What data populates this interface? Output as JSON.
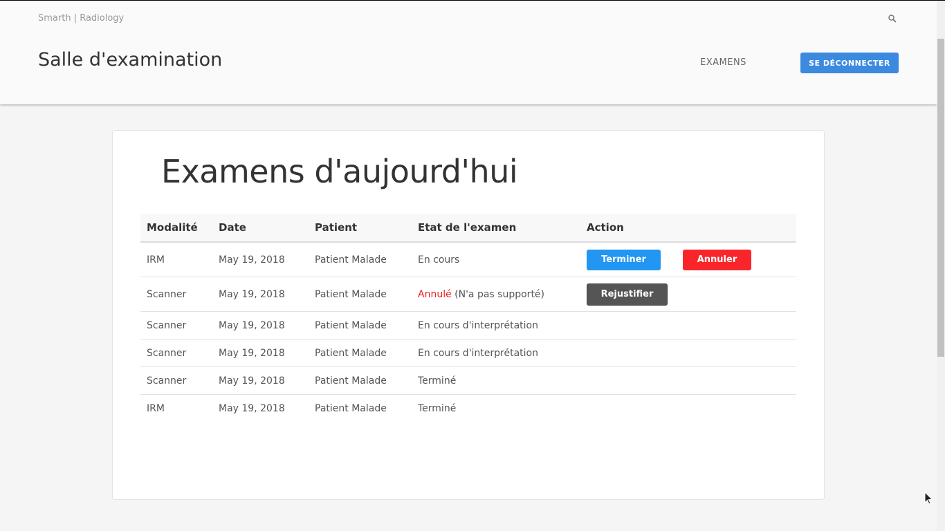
{
  "header": {
    "brand": "Smarth | Radiology",
    "title": "Salle d'examination",
    "nav_examens": "EXAMENS",
    "logout_label": "SE DÉCONNECTER"
  },
  "main": {
    "title": "Examens d'aujourd'hui",
    "columns": [
      "Modalité",
      "Date",
      "Patient",
      "Etat de l'examen",
      "Action"
    ],
    "rows": [
      {
        "modality": "IRM",
        "date": "May 19, 2018",
        "patient": "Patient Malade",
        "status": "En cours",
        "status_note": "",
        "actions": [
          "Terminer",
          "Annuler"
        ]
      },
      {
        "modality": "Scanner",
        "date": "May 19, 2018",
        "patient": "Patient Malade",
        "status": "Annulé",
        "status_note": " (N'a pas supporté)",
        "actions": [
          "Rejustifier"
        ]
      },
      {
        "modality": "Scanner",
        "date": "May 19, 2018",
        "patient": "Patient Malade",
        "status": "En cours d'interprétation",
        "status_note": "",
        "actions": []
      },
      {
        "modality": "Scanner",
        "date": "May 19, 2018",
        "patient": "Patient Malade",
        "status": "En cours d'interprétation",
        "status_note": "",
        "actions": []
      },
      {
        "modality": "Scanner",
        "date": "May 19, 2018",
        "patient": "Patient Malade",
        "status": "Terminé",
        "status_note": "",
        "actions": []
      },
      {
        "modality": "IRM",
        "date": "May 19, 2018",
        "patient": "Patient Malade",
        "status": "Terminé",
        "status_note": "",
        "actions": []
      }
    ]
  },
  "colors": {
    "primary": "#3b8ae0",
    "terminer": "#2196f3",
    "annuler": "#f8262b",
    "rejustifier": "#555555",
    "cancelled_text": "#e8201c"
  },
  "icons": {
    "search": "search-icon"
  }
}
